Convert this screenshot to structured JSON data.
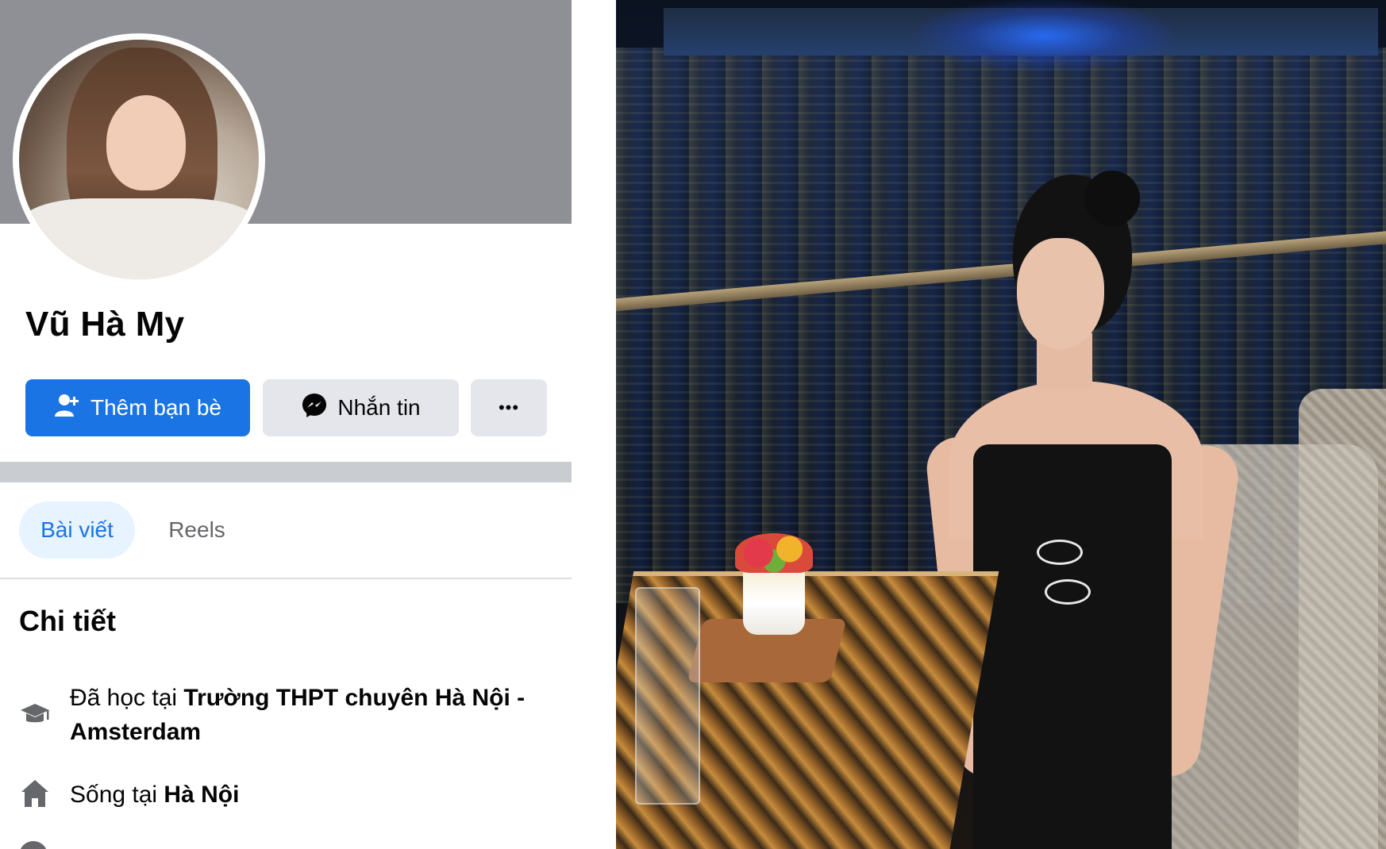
{
  "profile": {
    "name": "Vũ Hà My",
    "actions": {
      "add_friend": "Thêm bạn bè",
      "message": "Nhắn tin",
      "more": "•••"
    },
    "tabs": {
      "posts": "Bài viết",
      "reels": "Reels"
    },
    "details": {
      "title": "Chi tiết",
      "education_prefix": "Đã học tại ",
      "education_value": "Trường THPT chuyên Hà Nội - Amsterdam",
      "lives_prefix": "Sống tại ",
      "lives_value": "Hà Nội"
    }
  },
  "colors": {
    "primary": "#1b74e4",
    "secondary_button": "#e4e6eb",
    "active_tab_bg": "#e7f3ff",
    "cover": "#8f9095",
    "divider": "#c9ccd1"
  },
  "icons": {
    "add_friend": "person-plus-icon",
    "message": "messenger-icon",
    "more": "more-dots-icon",
    "education": "graduation-cap-icon",
    "home": "home-icon"
  }
}
